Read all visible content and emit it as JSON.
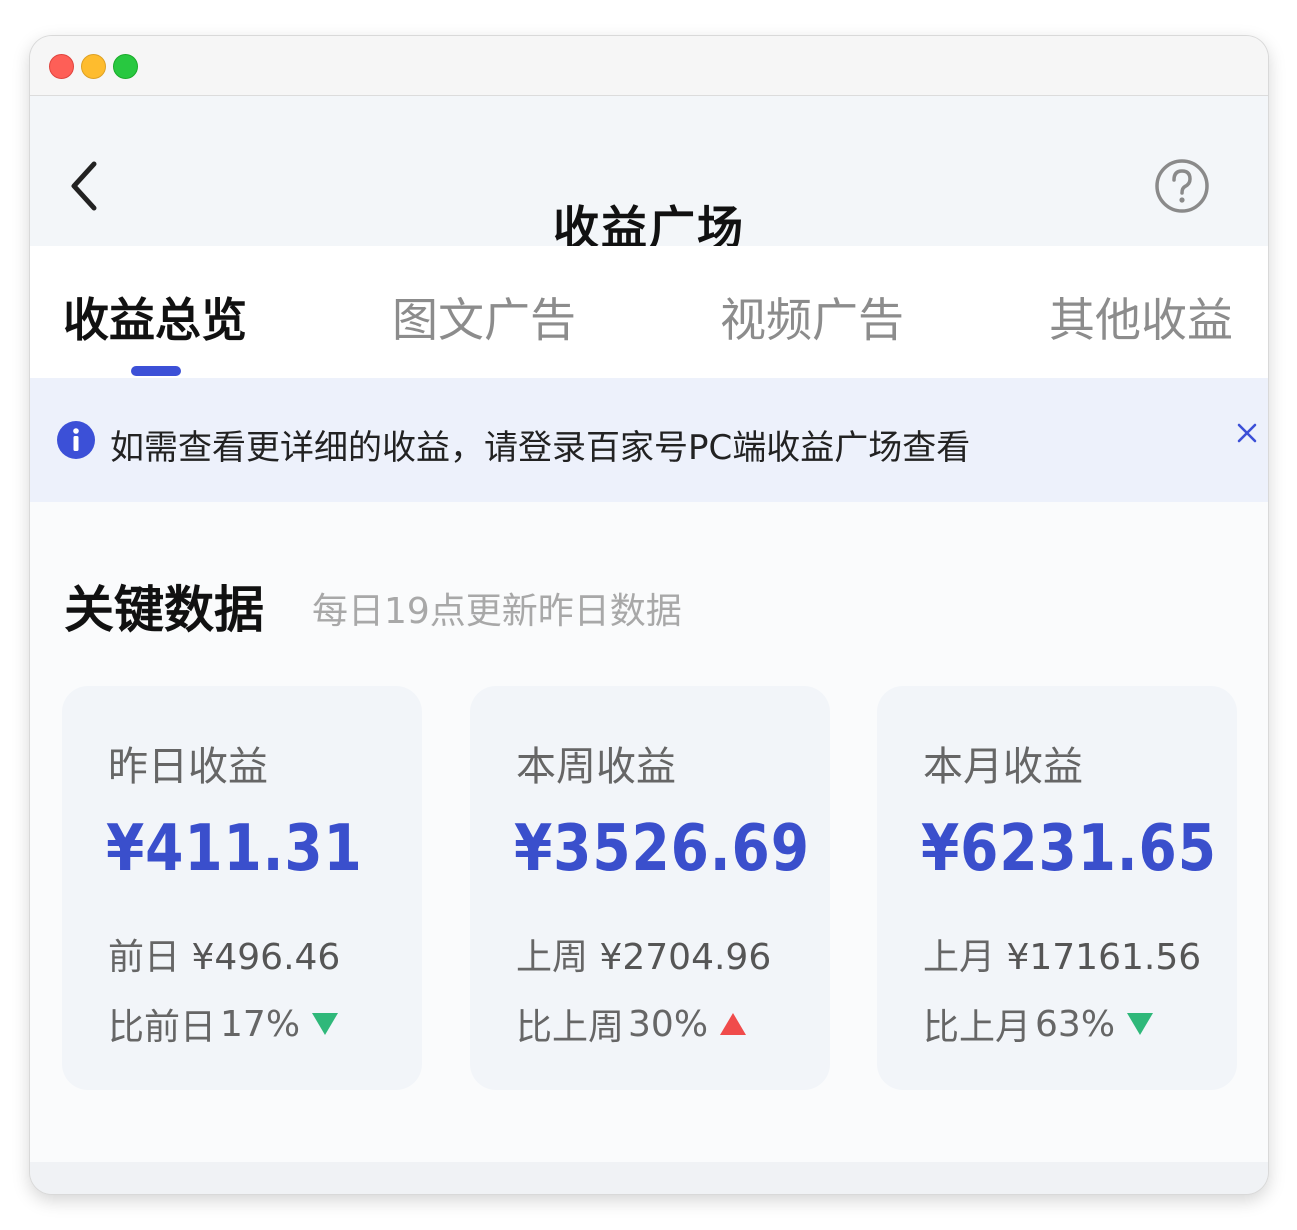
{
  "header": {
    "title": "收益广场"
  },
  "tabs": [
    {
      "label": "收益总览",
      "active": true
    },
    {
      "label": "图文广告",
      "active": false
    },
    {
      "label": "视频广告",
      "active": false
    },
    {
      "label": "其他收益",
      "active": false
    }
  ],
  "notice": {
    "text": "如需查看更详细的收益，请登录百家号PC端收益广场查看"
  },
  "section": {
    "title": "关键数据",
    "subtitle": "每日19点更新昨日数据"
  },
  "cards": [
    {
      "label": "昨日收益",
      "value": "¥411.31",
      "prev_label": "前日",
      "prev_value": "¥496.46",
      "compare_label": "比前日",
      "compare_pct": "17%",
      "trend": "down"
    },
    {
      "label": "本周收益",
      "value": "¥3526.69",
      "prev_label": "上周",
      "prev_value": "¥2704.96",
      "compare_label": "比上周",
      "compare_pct": "30%",
      "trend": "up"
    },
    {
      "label": "本月收益",
      "value": "¥6231.65",
      "prev_label": "上月",
      "prev_value": "¥17161.56",
      "compare_label": "比上月",
      "compare_pct": "63%",
      "trend": "down"
    }
  ],
  "colors": {
    "accent": "#3a4fcc",
    "trend_up": "#f04b4b",
    "trend_down": "#2fb87a",
    "info": "#3c50d7"
  },
  "icons": {
    "back": "chevron-left-icon",
    "help": "question-circle-icon",
    "info": "info-circle-icon",
    "close": "close-icon",
    "trend_up": "triangle-up-icon",
    "trend_down": "triangle-down-icon"
  }
}
